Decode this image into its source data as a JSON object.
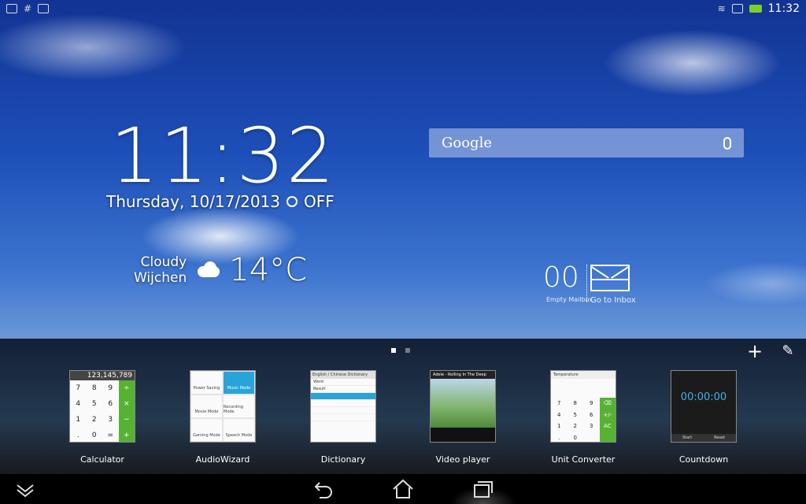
{
  "status_bar": {
    "notification_icons": [
      "download-icon",
      "hash-icon",
      "image-icon"
    ],
    "status_icons": [
      "wifi-icon",
      "sd-card-icon",
      "battery-charging-icon"
    ],
    "time": "11:32"
  },
  "clock_widget": {
    "time": "11:32",
    "date": "Thursday, 10/17/2013",
    "alarm": "OFF",
    "weather_condition": "Cloudy",
    "location": "Wijchen",
    "temperature": "14°C"
  },
  "search_widget": {
    "label": "Google"
  },
  "mail_widget": {
    "count": "00",
    "empty_label": "Empty Mailbox",
    "inbox_label": "Go to Inbox"
  },
  "recents": {
    "apps": [
      {
        "label": "Calculator"
      },
      {
        "label": "AudioWizard"
      },
      {
        "label": "Dictionary"
      },
      {
        "label": "Video player"
      },
      {
        "label": "Unit Converter"
      },
      {
        "label": "Countdown"
      }
    ],
    "calculator": {
      "display": "123,145,789",
      "keys": [
        "7",
        "8",
        "9",
        "÷",
        "4",
        "5",
        "6",
        "×",
        "1",
        "2",
        "3",
        "−",
        ".",
        "0",
        "=",
        "+"
      ]
    },
    "audiowizard": {
      "modes": [
        "Power Saving",
        "Music Mode",
        "Movie Mode",
        "Recording Mode",
        "Gaming Mode",
        "Speech Mode"
      ]
    },
    "dictionary": {
      "header": "English / Chinese Dictionary",
      "lines": [
        "Word",
        "Result",
        "",
        "",
        "",
        ""
      ]
    },
    "video": {
      "title": "Adele - Rolling In The Deep"
    },
    "unit_converter": {
      "header": "Temperature",
      "keys": [
        "7",
        "8",
        "9",
        "⌫",
        "4",
        "5",
        "6",
        "+/-",
        "1",
        "2",
        "3",
        "AC",
        ".",
        "0",
        "",
        ""
      ]
    },
    "countdown": {
      "time": "00:00:00",
      "start": "Start",
      "reset": "Reset"
    }
  },
  "colors": {
    "accent_green": "#57b233",
    "accent_blue": "#2aa3d8"
  }
}
